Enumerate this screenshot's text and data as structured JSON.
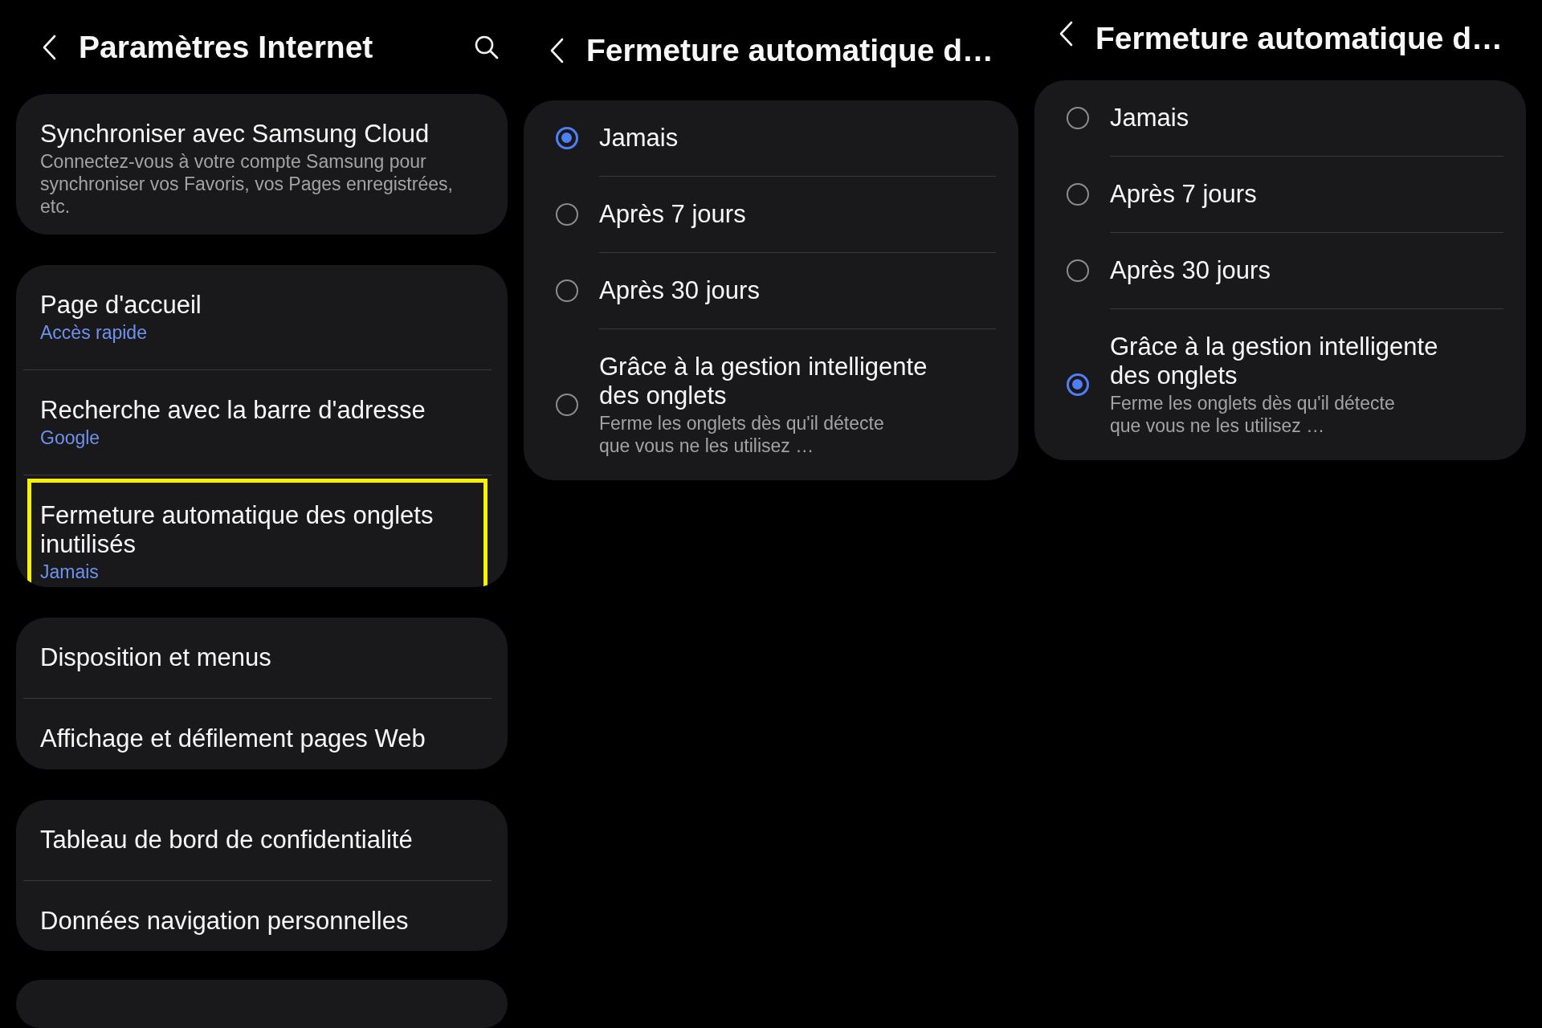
{
  "screens": [
    {
      "kind": "settings",
      "title": "Paramètres Internet",
      "groups": [
        {
          "items": [
            {
              "title": "Synchroniser avec Samsung Cloud",
              "description": "Connectez-vous à votre compte Samsung pour synchroniser vos Favoris, vos Pages enregistrées, etc.",
              "highlighted": false
            }
          ]
        },
        {
          "items": [
            {
              "title": "Page d'accueil",
              "value": "Accès rapide",
              "highlighted": false
            },
            {
              "title": "Recherche avec la barre d'adresse",
              "value": "Google",
              "highlighted": false
            },
            {
              "title": "Fermeture automatique des onglets inutilisés",
              "value": "Jamais",
              "highlighted": true
            }
          ]
        },
        {
          "items": [
            {
              "title": "Disposition et menus",
              "highlighted": false
            },
            {
              "title": "Affichage et défilement pages Web",
              "highlighted": false
            }
          ]
        },
        {
          "items": [
            {
              "title": "Tableau de bord de confidentialité",
              "highlighted": false
            },
            {
              "title": "Données navigation personnelles",
              "highlighted": false
            }
          ]
        }
      ]
    },
    {
      "kind": "options",
      "title": "Fermeture automatique d…",
      "options": [
        {
          "label": "Jamais",
          "selected": true
        },
        {
          "label": "Après 7 jours",
          "selected": false
        },
        {
          "label": "Après 30 jours",
          "selected": false
        },
        {
          "label": "Grâce à la gestion intelligente des onglets",
          "description": "Ferme les onglets dès qu'il détecte que vous ne les utilisez …",
          "selected": false
        }
      ]
    },
    {
      "kind": "options",
      "title": "Fermeture automatique d…",
      "options": [
        {
          "label": "Jamais",
          "selected": false
        },
        {
          "label": "Après 7 jours",
          "selected": false
        },
        {
          "label": "Après 30 jours",
          "selected": false
        },
        {
          "label": "Grâce à la gestion intelligente des onglets",
          "description": "Ferme les onglets dès qu'il détecte que vous ne les utilisez …",
          "selected": true
        }
      ]
    }
  ]
}
